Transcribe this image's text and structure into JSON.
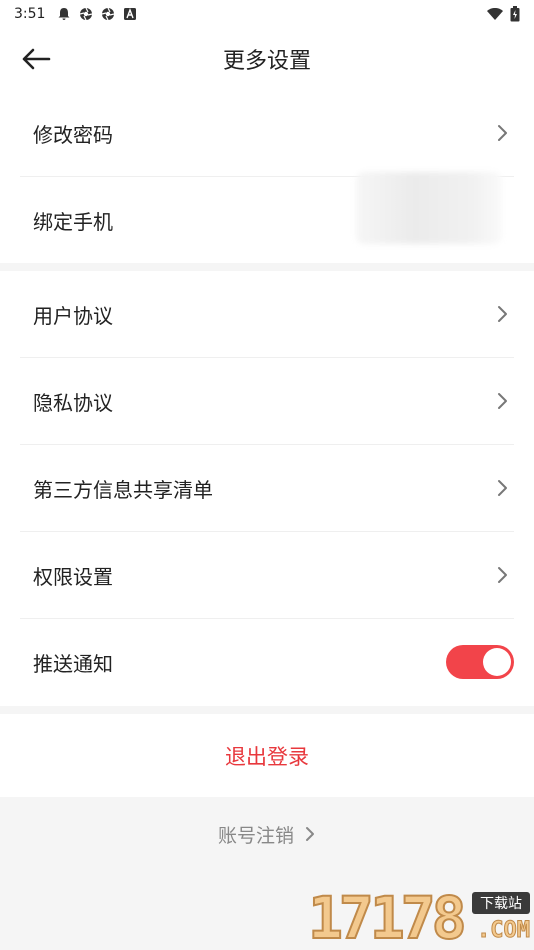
{
  "status_bar": {
    "time": "3:51",
    "icons_left": [
      "bell-icon",
      "aperture-icon",
      "aperture-icon",
      "a-badge-icon"
    ],
    "icons_right": [
      "wifi-icon",
      "battery-icon"
    ]
  },
  "header": {
    "title": "更多设置",
    "back_icon": "arrow-left-icon"
  },
  "group1": {
    "items": [
      {
        "label": "修改密码",
        "icon": "chevron-right-icon"
      },
      {
        "label": "绑定手机"
      }
    ]
  },
  "group2": {
    "items": [
      {
        "label": "用户协议",
        "icon": "chevron-right-icon"
      },
      {
        "label": "隐私协议",
        "icon": "chevron-right-icon"
      },
      {
        "label": "第三方信息共享清单",
        "icon": "chevron-right-icon"
      },
      {
        "label": "权限设置",
        "icon": "chevron-right-icon"
      },
      {
        "label": "推送通知",
        "toggle_on": true
      }
    ]
  },
  "logout": {
    "label": "退出登录"
  },
  "cancel_account": {
    "label": "账号注销"
  },
  "watermark": {
    "digits": "17178",
    "tag": "下载站",
    "domain": ".COM"
  },
  "colors": {
    "accent": "#f2444a",
    "logout_text": "#e8383d",
    "page_bg": "#f5f5f5",
    "card_bg": "#ffffff",
    "muted_text": "#888888"
  }
}
